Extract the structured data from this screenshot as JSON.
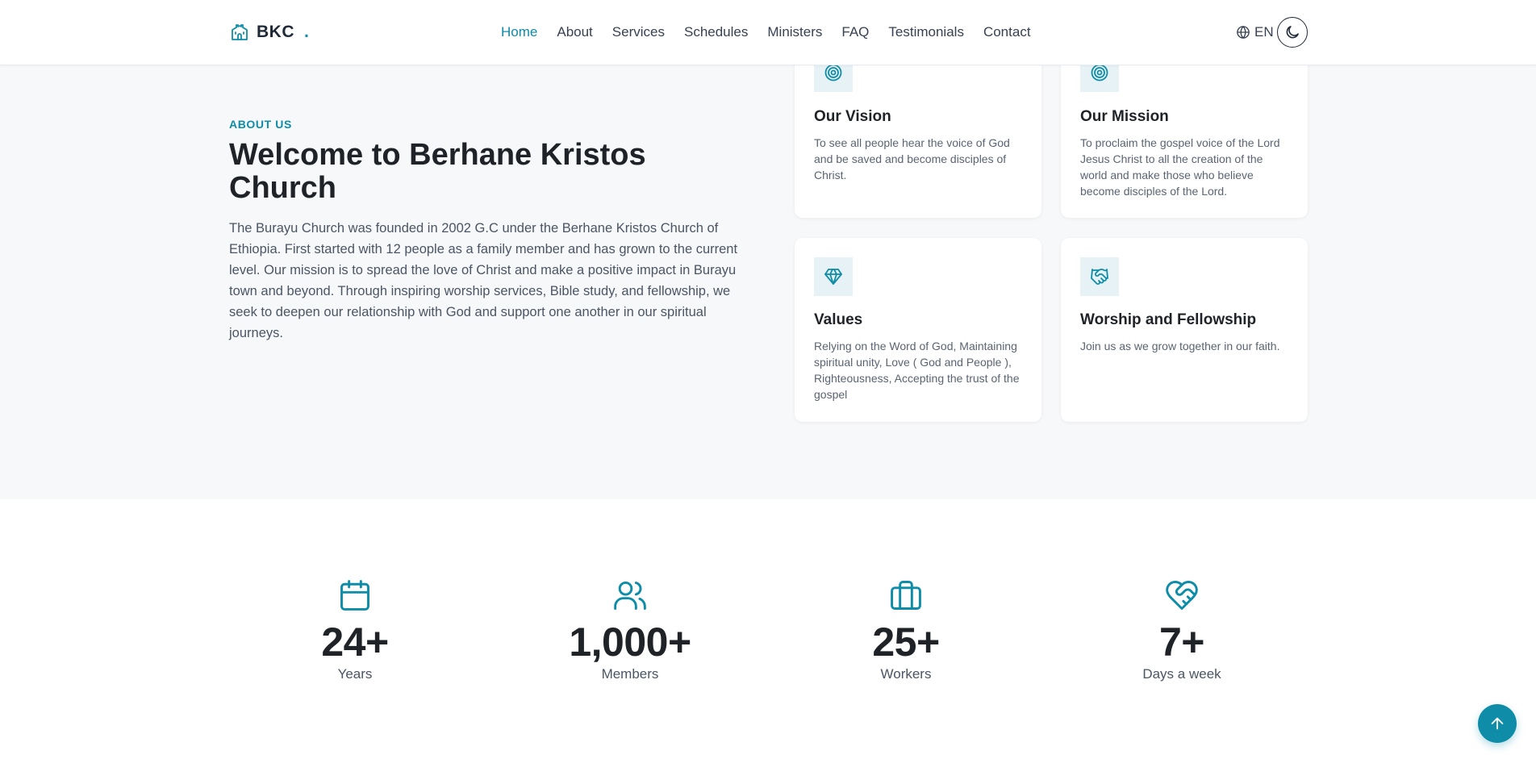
{
  "brand": {
    "name": "BKC",
    "dot": ".",
    "accent": "#0e8ca8"
  },
  "nav": {
    "items": [
      "Home",
      "About",
      "Services",
      "Schedules",
      "Ministers",
      "FAQ",
      "Testimonials",
      "Contact"
    ],
    "active": "Home"
  },
  "lang": {
    "label": "EN",
    "icon": "globe-icon"
  },
  "theme_toggle": {
    "icon": "moon-icon"
  },
  "about": {
    "eyebrow": "ABOUT US",
    "title": "Welcome to Berhane Kristos Church",
    "body": "The Burayu Church was founded in 2002 G.C under the Berhane Kristos Church of Ethiopia. First started with 12 people as a family member and has grown to the current level. Our mission is to spread the love of Christ and make a positive impact in Burayu town and beyond. Through inspiring worship services, Bible study, and fellowship, we seek to deepen our relationship with God and support one another in our spiritual journeys."
  },
  "cards": [
    {
      "icon": "target-icon",
      "title": "Our Vision",
      "text": "To see all people hear the voice of God and be saved and become disciples of Christ."
    },
    {
      "icon": "target-icon",
      "title": "Our Mission",
      "text": "To proclaim the gospel voice of the Lord Jesus Christ to all the creation of the world and make those who believe become disciples of the Lord."
    },
    {
      "icon": "gem-icon",
      "title": "Values",
      "text": "Relying on the Word of God, Maintaining spiritual unity, Love ( God and People ), Righteousness, Accepting the trust of the gospel"
    },
    {
      "icon": "handshake-icon",
      "title": "Worship and Fellowship",
      "text": "Join us as we grow together in our faith."
    }
  ],
  "stats": [
    {
      "icon": "calendar-icon",
      "value": "24+",
      "label": "Years"
    },
    {
      "icon": "users-icon",
      "value": "1,000+",
      "label": "Members"
    },
    {
      "icon": "briefcase-icon",
      "value": "25+",
      "label": "Workers"
    },
    {
      "icon": "heart-handshake-icon",
      "value": "7+",
      "label": "Days a week"
    }
  ],
  "back_to_top": {
    "icon": "arrow-up-icon"
  }
}
